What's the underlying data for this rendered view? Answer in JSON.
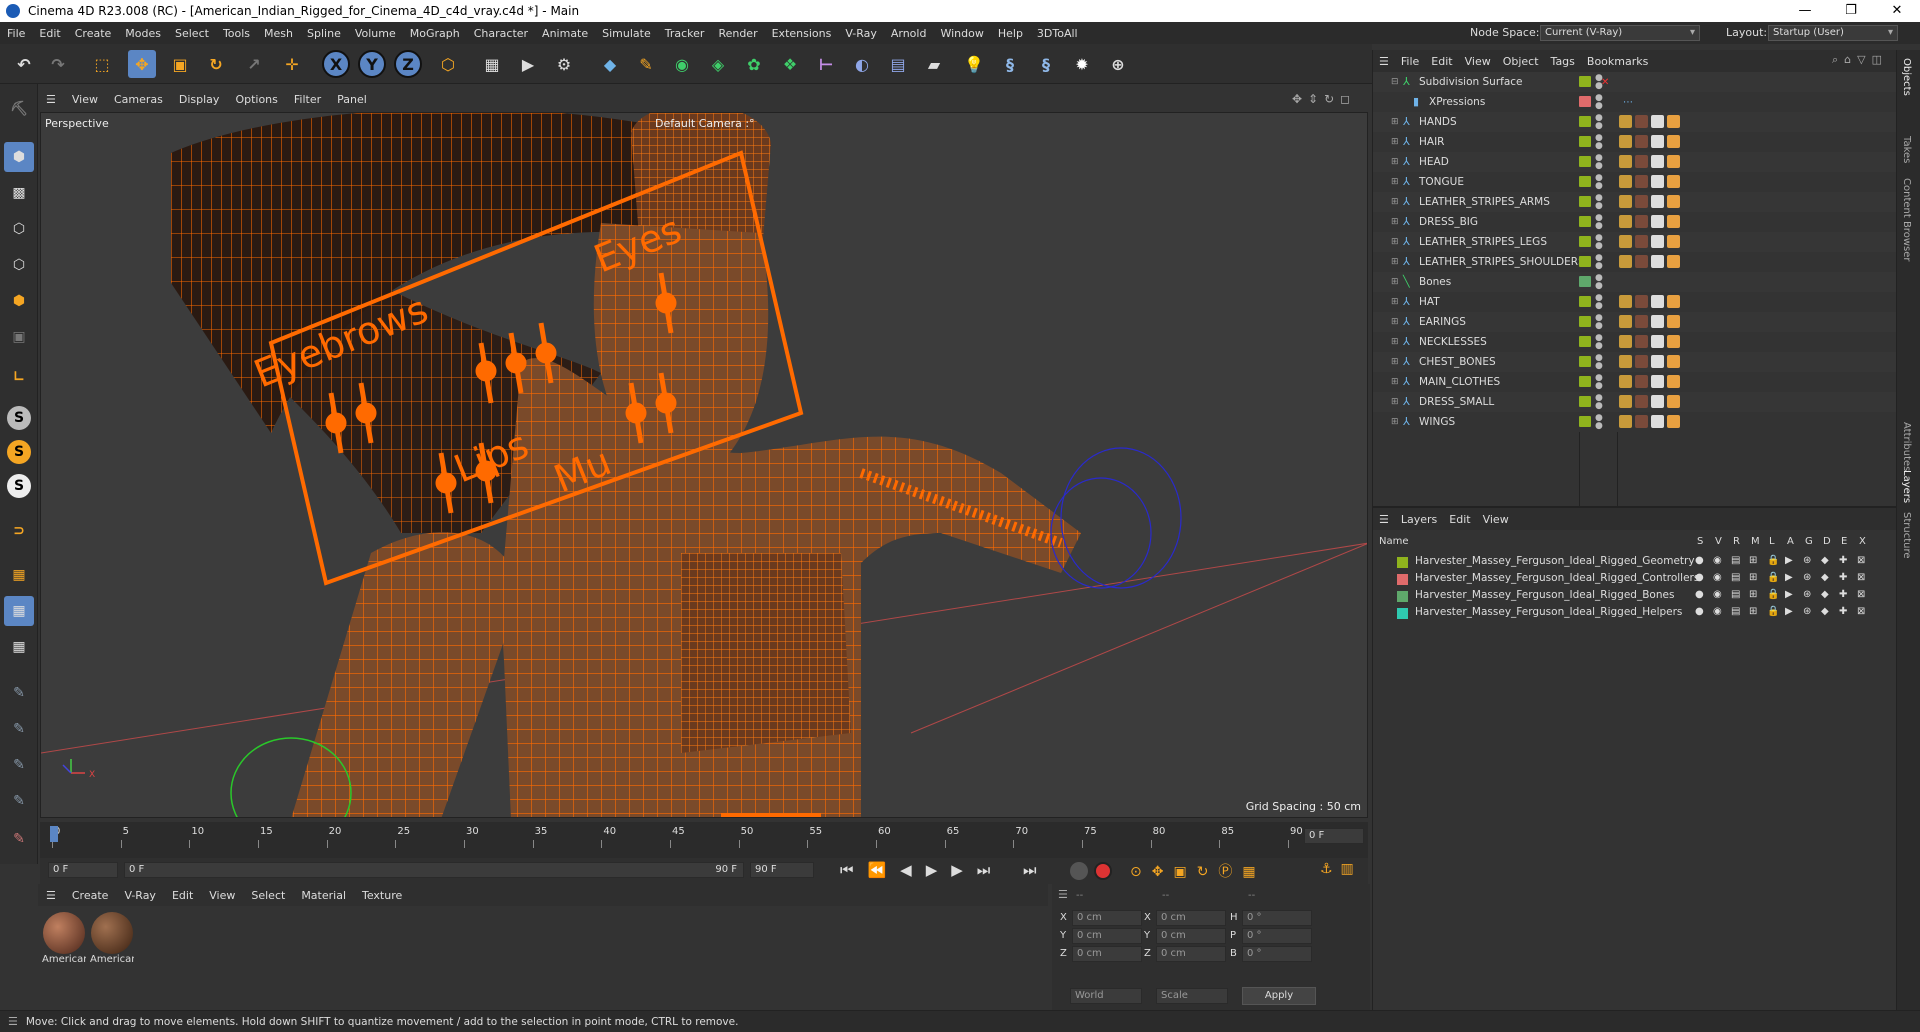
{
  "window": {
    "title": "Cinema 4D R23.008 (RC) - [American_Indian_Rigged_for_Cinema_4D_c4d_vray.c4d *] - Main",
    "controls": [
      "—",
      "❐",
      "✕"
    ]
  },
  "menubar": {
    "items": [
      "File",
      "Edit",
      "Create",
      "Modes",
      "Select",
      "Tools",
      "Mesh",
      "Spline",
      "Volume",
      "MoGraph",
      "Character",
      "Animate",
      "Simulate",
      "Tracker",
      "Render",
      "Extensions",
      "V-Ray",
      "Arnold",
      "Window",
      "Help",
      "3DToAll"
    ],
    "node_space_label": "Node Space:",
    "node_space_value": "Current (V-Ray)",
    "layout_label": "Layout:",
    "layout_value": "Startup (User)"
  },
  "toolbar": {
    "axis": [
      "X",
      "Y",
      "Z"
    ]
  },
  "viewport": {
    "menu": [
      "View",
      "Cameras",
      "Display",
      "Options",
      "Filter",
      "Panel"
    ],
    "view_name": "Perspective",
    "camera": "Default Camera :°",
    "grid_spacing": "Grid Spacing : 50 cm",
    "rig_labels": {
      "eyebrows": "Eyebrows",
      "eyes": "Eyes",
      "lips": "Lips",
      "mu": "Mu"
    }
  },
  "timeline": {
    "ticks": [
      "0",
      "5",
      "10",
      "15",
      "20",
      "25",
      "30",
      "35",
      "40",
      "45",
      "50",
      "55",
      "60",
      "65",
      "70",
      "75",
      "80",
      "85",
      "90"
    ],
    "current_frame": "0 F"
  },
  "transport": {
    "start": "0 F",
    "cur": "0 F",
    "end_a": "90 F",
    "end_b": "90 F"
  },
  "material_manager": {
    "menu": [
      "Create",
      "V-Ray",
      "Edit",
      "View",
      "Select",
      "Material",
      "Texture"
    ],
    "materials": [
      "American",
      "American"
    ]
  },
  "coords": {
    "header_a": "--",
    "header_b": "--",
    "header_c": "--",
    "rows": [
      {
        "a": "X",
        "av": "0 cm",
        "b": "X",
        "bv": "0 cm",
        "c": "H",
        "cv": "0 °"
      },
      {
        "a": "Y",
        "av": "0 cm",
        "b": "Y",
        "bv": "0 cm",
        "c": "P",
        "cv": "0 °"
      },
      {
        "a": "Z",
        "av": "0 cm",
        "b": "Z",
        "bv": "0 cm",
        "c": "B",
        "cv": "0 °"
      }
    ],
    "world": "World",
    "scale": "Scale",
    "apply": "Apply"
  },
  "status": {
    "text": "Move: Click and drag to move elements. Hold down SHIFT to quantize movement / add to the selection in point mode, CTRL to remove."
  },
  "objects": {
    "menu": [
      "File",
      "Edit",
      "View",
      "Object",
      "Tags",
      "Bookmarks"
    ],
    "rows": [
      {
        "name": "Subdivision Surface",
        "color": "#8fb31d"
      },
      {
        "name": "XPressions",
        "color": "#e06b6b"
      },
      {
        "name": "HANDS",
        "color": "#8fb31d"
      },
      {
        "name": "HAIR",
        "color": "#8fb31d"
      },
      {
        "name": "HEAD",
        "color": "#8fb31d"
      },
      {
        "name": "TONGUE",
        "color": "#8fb31d"
      },
      {
        "name": "LEATHER_STRIPES_ARMS",
        "color": "#8fb31d"
      },
      {
        "name": "DRESS_BIG",
        "color": "#8fb31d"
      },
      {
        "name": "LEATHER_STRIPES_LEGS",
        "color": "#8fb31d"
      },
      {
        "name": "LEATHER_STRIPES_SHOULDERS",
        "color": "#8fb31d"
      },
      {
        "name": "Bones",
        "color": "#5fa86b"
      },
      {
        "name": "HAT",
        "color": "#8fb31d"
      },
      {
        "name": "EARINGS",
        "color": "#8fb31d"
      },
      {
        "name": "NECKLESSES",
        "color": "#8fb31d"
      },
      {
        "name": "CHEST_BONES",
        "color": "#8fb31d"
      },
      {
        "name": "MAIN_CLOTHES",
        "color": "#8fb31d"
      },
      {
        "name": "DRESS_SMALL",
        "color": "#8fb31d"
      },
      {
        "name": "WINGS",
        "color": "#8fb31d"
      }
    ]
  },
  "layers": {
    "menu": [
      "Layers",
      "Edit",
      "View"
    ],
    "head_name": "Name",
    "cols": [
      "S",
      "V",
      "R",
      "M",
      "L",
      "A",
      "G",
      "D",
      "E",
      "X"
    ],
    "rows": [
      {
        "name": "Harvester_Massey_Ferguson_Ideal_Rigged_Geometry",
        "color": "#8fb31d"
      },
      {
        "name": "Harvester_Massey_Ferguson_Ideal_Rigged_Controllers",
        "color": "#e06b6b"
      },
      {
        "name": "Harvester_Massey_Ferguson_Ideal_Rigged_Bones",
        "color": "#5fa86b"
      },
      {
        "name": "Harvester_Massey_Ferguson_Ideal_Rigged_Helpers",
        "color": "#2fc9b0"
      }
    ]
  },
  "sidetabs": [
    "Objects",
    "Takes",
    "Content Browser",
    "Attributes",
    "Layers",
    "Structure"
  ],
  "colors": {
    "accent": "#5b86c4",
    "wire": "#ff6a00"
  }
}
